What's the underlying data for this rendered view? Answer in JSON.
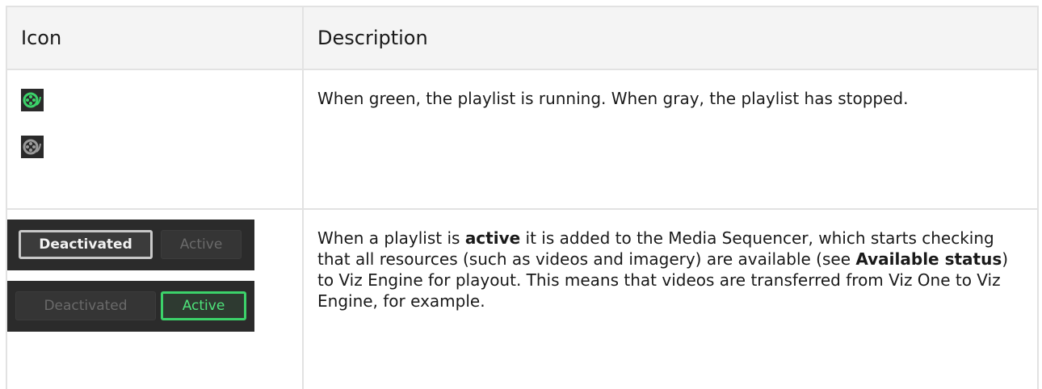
{
  "table": {
    "headers": [
      "Icon",
      "Description"
    ],
    "row1": {
      "icons": [
        "playlist-running-green-icon",
        "playlist-stopped-gray-icon"
      ],
      "description": "When green, the playlist is running. When gray, the playlist has stopped."
    },
    "row2": {
      "toggle_a": {
        "left_label": "Deactivated",
        "right_label": "Active",
        "selected": "Deactivated"
      },
      "toggle_b": {
        "left_label": "Deactivated",
        "right_label": "Active",
        "selected": "Active"
      },
      "desc_part1": "When a playlist is ",
      "desc_bold1": "active",
      "desc_part2": " it is added to the Media Sequencer, which starts checking that all resources (such as videos and imagery) are available (see ",
      "desc_bold2": "Available status",
      "desc_part3": ") to Viz Engine for playout. This means that videos are transferred from Viz One to Viz Engine, for example."
    }
  },
  "colors": {
    "running": "#3cd26a",
    "stopped": "#9a9a9a",
    "header_bg": "#f4f4f4",
    "border": "#e2e2e2"
  }
}
